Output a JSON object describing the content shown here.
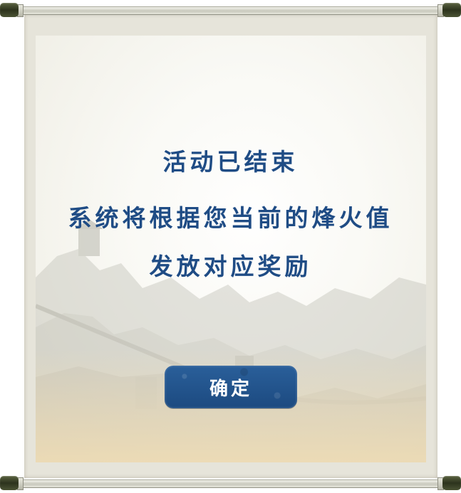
{
  "dialog": {
    "line1": "活动已结束",
    "line2": "系统将根据您当前的烽火值",
    "line3": "发放对应奖励",
    "confirm_label": "确定"
  },
  "colors": {
    "text_blue": "#1f4c85",
    "button_blue": "#1c4a80",
    "rod_cap": "#2d331d"
  }
}
